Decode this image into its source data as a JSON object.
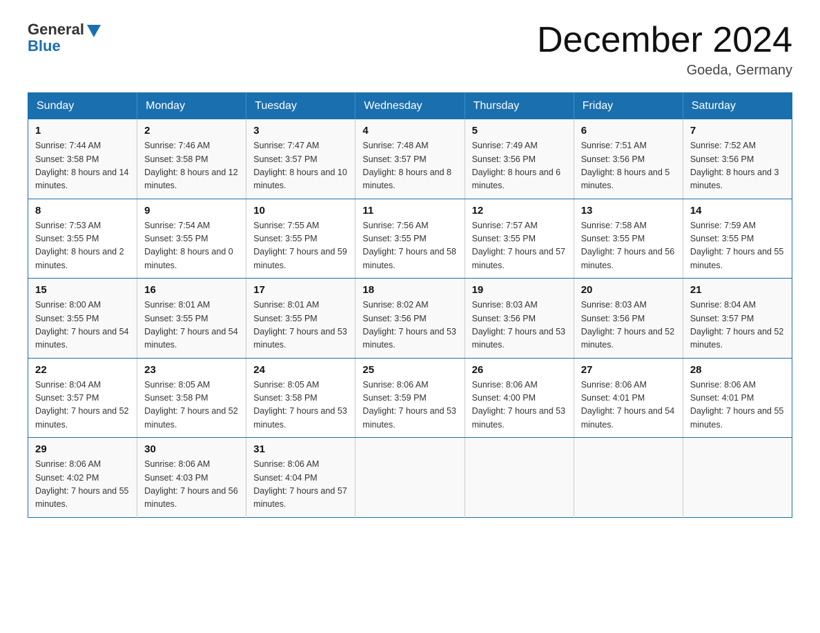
{
  "header": {
    "logo_general": "General",
    "logo_blue": "Blue",
    "month_title": "December 2024",
    "location": "Goeda, Germany"
  },
  "weekdays": [
    "Sunday",
    "Monday",
    "Tuesday",
    "Wednesday",
    "Thursday",
    "Friday",
    "Saturday"
  ],
  "weeks": [
    [
      {
        "day": "1",
        "sunrise": "7:44 AM",
        "sunset": "3:58 PM",
        "daylight": "8 hours and 14 minutes."
      },
      {
        "day": "2",
        "sunrise": "7:46 AM",
        "sunset": "3:58 PM",
        "daylight": "8 hours and 12 minutes."
      },
      {
        "day": "3",
        "sunrise": "7:47 AM",
        "sunset": "3:57 PM",
        "daylight": "8 hours and 10 minutes."
      },
      {
        "day": "4",
        "sunrise": "7:48 AM",
        "sunset": "3:57 PM",
        "daylight": "8 hours and 8 minutes."
      },
      {
        "day": "5",
        "sunrise": "7:49 AM",
        "sunset": "3:56 PM",
        "daylight": "8 hours and 6 minutes."
      },
      {
        "day": "6",
        "sunrise": "7:51 AM",
        "sunset": "3:56 PM",
        "daylight": "8 hours and 5 minutes."
      },
      {
        "day": "7",
        "sunrise": "7:52 AM",
        "sunset": "3:56 PM",
        "daylight": "8 hours and 3 minutes."
      }
    ],
    [
      {
        "day": "8",
        "sunrise": "7:53 AM",
        "sunset": "3:55 PM",
        "daylight": "8 hours and 2 minutes."
      },
      {
        "day": "9",
        "sunrise": "7:54 AM",
        "sunset": "3:55 PM",
        "daylight": "8 hours and 0 minutes."
      },
      {
        "day": "10",
        "sunrise": "7:55 AM",
        "sunset": "3:55 PM",
        "daylight": "7 hours and 59 minutes."
      },
      {
        "day": "11",
        "sunrise": "7:56 AM",
        "sunset": "3:55 PM",
        "daylight": "7 hours and 58 minutes."
      },
      {
        "day": "12",
        "sunrise": "7:57 AM",
        "sunset": "3:55 PM",
        "daylight": "7 hours and 57 minutes."
      },
      {
        "day": "13",
        "sunrise": "7:58 AM",
        "sunset": "3:55 PM",
        "daylight": "7 hours and 56 minutes."
      },
      {
        "day": "14",
        "sunrise": "7:59 AM",
        "sunset": "3:55 PM",
        "daylight": "7 hours and 55 minutes."
      }
    ],
    [
      {
        "day": "15",
        "sunrise": "8:00 AM",
        "sunset": "3:55 PM",
        "daylight": "7 hours and 54 minutes."
      },
      {
        "day": "16",
        "sunrise": "8:01 AM",
        "sunset": "3:55 PM",
        "daylight": "7 hours and 54 minutes."
      },
      {
        "day": "17",
        "sunrise": "8:01 AM",
        "sunset": "3:55 PM",
        "daylight": "7 hours and 53 minutes."
      },
      {
        "day": "18",
        "sunrise": "8:02 AM",
        "sunset": "3:56 PM",
        "daylight": "7 hours and 53 minutes."
      },
      {
        "day": "19",
        "sunrise": "8:03 AM",
        "sunset": "3:56 PM",
        "daylight": "7 hours and 53 minutes."
      },
      {
        "day": "20",
        "sunrise": "8:03 AM",
        "sunset": "3:56 PM",
        "daylight": "7 hours and 52 minutes."
      },
      {
        "day": "21",
        "sunrise": "8:04 AM",
        "sunset": "3:57 PM",
        "daylight": "7 hours and 52 minutes."
      }
    ],
    [
      {
        "day": "22",
        "sunrise": "8:04 AM",
        "sunset": "3:57 PM",
        "daylight": "7 hours and 52 minutes."
      },
      {
        "day": "23",
        "sunrise": "8:05 AM",
        "sunset": "3:58 PM",
        "daylight": "7 hours and 52 minutes."
      },
      {
        "day": "24",
        "sunrise": "8:05 AM",
        "sunset": "3:58 PM",
        "daylight": "7 hours and 53 minutes."
      },
      {
        "day": "25",
        "sunrise": "8:06 AM",
        "sunset": "3:59 PM",
        "daylight": "7 hours and 53 minutes."
      },
      {
        "day": "26",
        "sunrise": "8:06 AM",
        "sunset": "4:00 PM",
        "daylight": "7 hours and 53 minutes."
      },
      {
        "day": "27",
        "sunrise": "8:06 AM",
        "sunset": "4:01 PM",
        "daylight": "7 hours and 54 minutes."
      },
      {
        "day": "28",
        "sunrise": "8:06 AM",
        "sunset": "4:01 PM",
        "daylight": "7 hours and 55 minutes."
      }
    ],
    [
      {
        "day": "29",
        "sunrise": "8:06 AM",
        "sunset": "4:02 PM",
        "daylight": "7 hours and 55 minutes."
      },
      {
        "day": "30",
        "sunrise": "8:06 AM",
        "sunset": "4:03 PM",
        "daylight": "7 hours and 56 minutes."
      },
      {
        "day": "31",
        "sunrise": "8:06 AM",
        "sunset": "4:04 PM",
        "daylight": "7 hours and 57 minutes."
      },
      null,
      null,
      null,
      null
    ]
  ]
}
